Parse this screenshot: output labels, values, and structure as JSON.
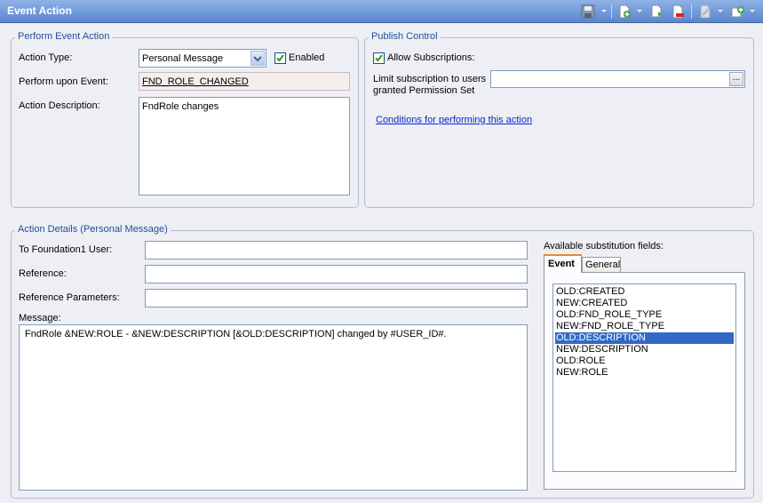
{
  "window": {
    "title": "Event Action"
  },
  "toolbar": {
    "icons": [
      "save-icon",
      "new-icon",
      "duplicate-icon",
      "delete-icon",
      "edit-icon",
      "add-icon"
    ]
  },
  "perform_event_action": {
    "legend": "Perform Event Action",
    "action_type_label": "Action Type:",
    "action_type_value": "Personal Message",
    "enabled_label": "Enabled",
    "enabled_checked": true,
    "perform_upon_label": "Perform upon Event:",
    "perform_upon_value": "FND_ROLE_CHANGED",
    "description_label": "Action Description:",
    "description_value": "FndRole changes"
  },
  "publish_control": {
    "legend": "Publish Control",
    "allow_label": "Allow Subscriptions:",
    "allow_checked": true,
    "limit_label_line1": "Limit subscription to users",
    "limit_label_line2": "granted Permission Set",
    "limit_value": "",
    "browse_label": "...",
    "conditions_link": "Conditions for performing this action"
  },
  "action_details": {
    "legend": "Action Details (Personal Message)",
    "to_user_label": "To Foundation1 User:",
    "to_user_value": "",
    "reference_label": "Reference:",
    "reference_value": "",
    "ref_params_label": "Reference Parameters:",
    "ref_params_value": "",
    "message_label": "Message:",
    "message_value": "FndRole &NEW:ROLE - &NEW:DESCRIPTION [&OLD:DESCRIPTION] changed by #USER_ID#."
  },
  "substitution": {
    "label": "Available substitution fields:",
    "tabs": [
      "Event",
      "General"
    ],
    "active_tab": "Event",
    "fields": [
      "OLD:CREATED",
      "NEW:CREATED",
      "OLD:FND_ROLE_TYPE",
      "NEW:FND_ROLE_TYPE",
      "OLD:DESCRIPTION",
      "NEW:DESCRIPTION",
      "OLD:ROLE",
      "NEW:ROLE"
    ],
    "selected": "OLD:DESCRIPTION"
  },
  "colors": {
    "title_bar": "#6a92d8",
    "accent_blue": "#1f4e9c",
    "selection": "#316ac5",
    "link": "#0a26c9"
  }
}
